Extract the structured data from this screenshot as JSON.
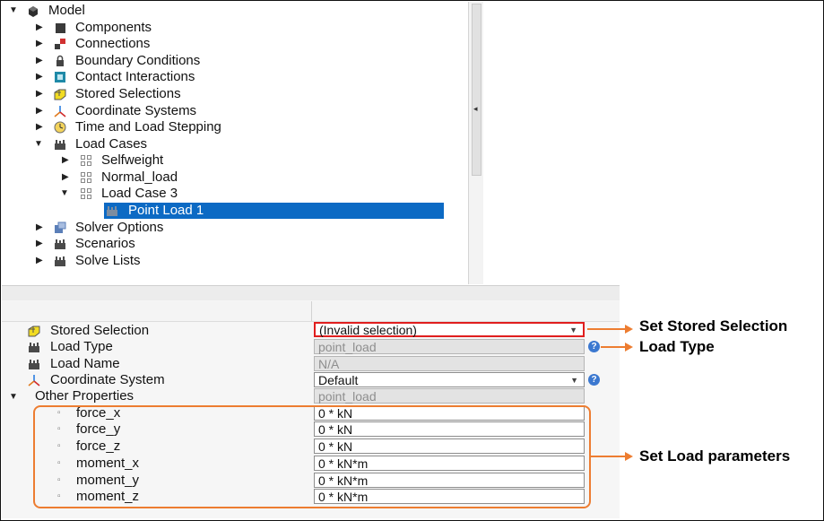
{
  "tree": {
    "root": "Model",
    "items": [
      {
        "label": "Components",
        "icon": "component-icon"
      },
      {
        "label": "Connections",
        "icon": "connection-icon"
      },
      {
        "label": "Boundary Conditions",
        "icon": "lock-icon"
      },
      {
        "label": "Contact Interactions",
        "icon": "contact-icon"
      },
      {
        "label": "Stored Selections",
        "icon": "selection-cube-icon"
      },
      {
        "label": "Coordinate Systems",
        "icon": "axes-icon"
      },
      {
        "label": "Time and Load Stepping",
        "icon": "clock-icon"
      },
      {
        "label": "Load Cases",
        "icon": "load-icon"
      }
    ],
    "load_cases": [
      "Selfweight",
      "Normal_load",
      "Load Case 3"
    ],
    "selected_item": "Point Load 1",
    "after_items": [
      {
        "label": "Solver Options",
        "icon": "solver-icon"
      },
      {
        "label": "Scenarios",
        "icon": "load-icon"
      },
      {
        "label": "Solve Lists",
        "icon": "load-icon"
      }
    ]
  },
  "properties": {
    "stored_selection": {
      "label": "Stored Selection",
      "value": "(Invalid selection)"
    },
    "load_type": {
      "label": "Load Type",
      "value": "point_load"
    },
    "load_name": {
      "label": "Load Name",
      "value": "N/A"
    },
    "coordinate_system": {
      "label": "Coordinate System",
      "value": "Default"
    },
    "other_properties": {
      "label": "Other Properties",
      "value": "point_load"
    },
    "params": [
      {
        "label": "force_x",
        "value": "0 * kN"
      },
      {
        "label": "force_y",
        "value": "0 * kN"
      },
      {
        "label": "force_z",
        "value": "0 * kN"
      },
      {
        "label": "moment_x",
        "value": "0 * kN*m"
      },
      {
        "label": "moment_y",
        "value": "0 * kN*m"
      },
      {
        "label": "moment_z",
        "value": "0 * kN*m"
      }
    ],
    "help_glyph": "?"
  },
  "annotations": {
    "stored_selection": "Set Stored Selection",
    "load_type": "Load Type",
    "load_params": "Set Load parameters"
  },
  "colors": {
    "selection_highlight": "#0c6ac4",
    "annotation_orange": "#ed7d31",
    "invalid_border": "#e01e1e"
  }
}
